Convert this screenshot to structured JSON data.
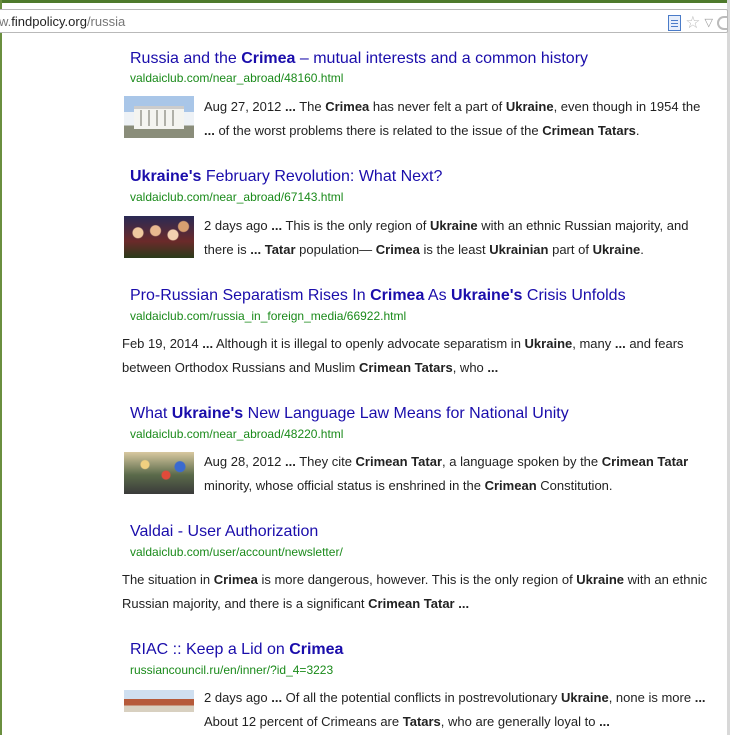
{
  "address_bar": {
    "url_prefix": "w.",
    "url_host": "findpolicy.org",
    "url_path": "/russia"
  },
  "icons": [
    "page-icon",
    "star-icon",
    "dropdown-icon",
    "refresh-icon"
  ],
  "results": [
    {
      "title_parts": [
        {
          "text": "Russia and the ",
          "bold": false
        },
        {
          "text": "Crimea",
          "bold": true
        },
        {
          "text": " – mutual interests and a common history",
          "bold": false
        }
      ],
      "url": "valdaiclub.com/near_abroad/48160.html",
      "thumbnail": "building-photo",
      "snippet_lines": [
        [
          {
            "text": "Aug 27, 2012 ",
            "bold": false
          },
          {
            "text": "...",
            "bold": true
          },
          {
            "text": " The ",
            "bold": false
          },
          {
            "text": "Crimea",
            "bold": true
          },
          {
            "text": " has never felt a part of ",
            "bold": false
          },
          {
            "text": "Ukraine",
            "bold": true
          },
          {
            "text": ", even though in 1954 the",
            "bold": false
          }
        ],
        [
          {
            "text": "...",
            "bold": true
          },
          {
            "text": " of the worst problems there is related to the issue of the ",
            "bold": false
          },
          {
            "text": "Crimean Tatars",
            "bold": true
          },
          {
            "text": ".",
            "bold": false
          }
        ]
      ]
    },
    {
      "title_parts": [
        {
          "text": "Ukraine's",
          "bold": true
        },
        {
          "text": " February Revolution: What Next?",
          "bold": false
        }
      ],
      "url": "valdaiclub.com/near_abroad/67143.html",
      "thumbnail": "crowd-photo",
      "snippet_lines": [
        [
          {
            "text": "2 days ago ",
            "bold": false
          },
          {
            "text": "...",
            "bold": true
          },
          {
            "text": " This is the only region of ",
            "bold": false
          },
          {
            "text": "Ukraine",
            "bold": true
          },
          {
            "text": " with an ethnic Russian majority, and",
            "bold": false
          }
        ],
        [
          {
            "text": "there is ",
            "bold": false
          },
          {
            "text": "...",
            "bold": true
          },
          {
            "text": " ",
            "bold": false
          },
          {
            "text": "Tatar",
            "bold": true
          },
          {
            "text": " population— ",
            "bold": false
          },
          {
            "text": "Crimea",
            "bold": true
          },
          {
            "text": " is the least ",
            "bold": false
          },
          {
            "text": "Ukrainian",
            "bold": true
          },
          {
            "text": " part of ",
            "bold": false
          },
          {
            "text": "Ukraine",
            "bold": true
          },
          {
            "text": ".",
            "bold": false
          }
        ]
      ]
    },
    {
      "title_parts": [
        {
          "text": "Pro-Russian Separatism Rises In ",
          "bold": false
        },
        {
          "text": "Crimea",
          "bold": true
        },
        {
          "text": " As ",
          "bold": false
        },
        {
          "text": "Ukraine's",
          "bold": true
        },
        {
          "text": " Crisis Unfolds",
          "bold": false
        }
      ],
      "url": "valdaiclub.com/russia_in_foreign_media/66922.html",
      "thumbnail": "",
      "snippet_lines": [
        [
          {
            "text": "Feb 19, 2014 ",
            "bold": false
          },
          {
            "text": "...",
            "bold": true
          },
          {
            "text": " Although it is illegal to openly advocate separatism in ",
            "bold": false
          },
          {
            "text": "Ukraine",
            "bold": true
          },
          {
            "text": ", many ",
            "bold": false
          },
          {
            "text": "...",
            "bold": true
          },
          {
            "text": " and fears",
            "bold": false
          }
        ],
        [
          {
            "text": "between Orthodox Russians and Muslim ",
            "bold": false
          },
          {
            "text": "Crimean Tatars",
            "bold": true
          },
          {
            "text": ", who ",
            "bold": false
          },
          {
            "text": "...",
            "bold": true
          }
        ]
      ]
    },
    {
      "title_parts": [
        {
          "text": "What ",
          "bold": false
        },
        {
          "text": "Ukraine's",
          "bold": true
        },
        {
          "text": " New Language Law Means for National Unity",
          "bold": false
        }
      ],
      "url": "valdaiclub.com/near_abroad/48220.html",
      "thumbnail": "rally-photo",
      "snippet_lines": [
        [
          {
            "text": "Aug 28, 2012 ",
            "bold": false
          },
          {
            "text": "...",
            "bold": true
          },
          {
            "text": " They cite ",
            "bold": false
          },
          {
            "text": "Crimean Tatar",
            "bold": true
          },
          {
            "text": ", a language spoken by the ",
            "bold": false
          },
          {
            "text": "Crimean Tatar",
            "bold": true
          }
        ],
        [
          {
            "text": "minority, whose official status is enshrined in the ",
            "bold": false
          },
          {
            "text": "Crimean",
            "bold": true
          },
          {
            "text": " Constitution.",
            "bold": false
          }
        ]
      ]
    },
    {
      "title_parts": [
        {
          "text": "Valdai - User Authorization",
          "bold": false
        }
      ],
      "url": "valdaiclub.com/user/account/newsletter/",
      "thumbnail": "",
      "snippet_lines": [
        [
          {
            "text": "The situation in ",
            "bold": false
          },
          {
            "text": "Crimea",
            "bold": true
          },
          {
            "text": " is more dangerous, however. This is the only region of ",
            "bold": false
          },
          {
            "text": "Ukraine",
            "bold": true
          },
          {
            "text": " with an ethnic",
            "bold": false
          }
        ],
        [
          {
            "text": "Russian majority, and there is a significant ",
            "bold": false
          },
          {
            "text": "Crimean Tatar",
            "bold": true
          },
          {
            "text": "  ",
            "bold": false
          },
          {
            "text": "...",
            "bold": true
          }
        ]
      ]
    },
    {
      "title_parts": [
        {
          "text": "RIAC :: Keep a Lid on ",
          "bold": false
        },
        {
          "text": "Crimea",
          "bold": true
        }
      ],
      "url": "russiancouncil.ru/en/inner/?id_4=3223",
      "thumbnail": "palace-photo",
      "snippet_lines": [
        [
          {
            "text": "2 days ago ",
            "bold": false
          },
          {
            "text": "...",
            "bold": true
          },
          {
            "text": " Of all the potential conflicts in postrevolutionary ",
            "bold": false
          },
          {
            "text": "Ukraine",
            "bold": true
          },
          {
            "text": ", none is more ",
            "bold": false
          },
          {
            "text": "...",
            "bold": true
          }
        ],
        [
          {
            "text": "About 12 percent of Crimeans are ",
            "bold": false
          },
          {
            "text": "Tatars",
            "bold": true
          },
          {
            "text": ", who are generally loyal to ",
            "bold": false
          },
          {
            "text": "...",
            "bold": true
          }
        ]
      ]
    }
  ]
}
